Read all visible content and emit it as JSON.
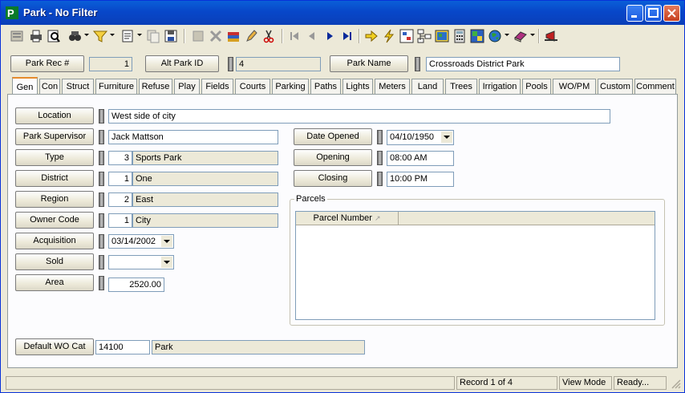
{
  "window": {
    "title": "Park - No Filter",
    "colors": {
      "titlebar": "#0a5fd8",
      "close": "#c7401f",
      "face": "#ece9d8"
    }
  },
  "toolbar": {
    "icons": [
      "new-record-icon",
      "print-icon",
      "preview-icon",
      "find-icon",
      "filter-icon",
      "report-icon",
      "copy-icon",
      "save-icon",
      "delete-icon",
      "attach-icon",
      "edit-icon",
      "cut-icon",
      "first-record-icon",
      "prev-record-icon",
      "next-record-icon",
      "last-record-icon",
      "go-icon",
      "lightning-icon",
      "hierarchy-icon",
      "tree-icon",
      "map-icon",
      "calculator-icon",
      "gis-icon",
      "globe-icon",
      "book-icon",
      "exit-icon"
    ]
  },
  "header": {
    "rec_label": "Park Rec #",
    "rec_value": "1",
    "alt_label": "Alt Park ID",
    "alt_value": "4",
    "name_label": "Park Name",
    "name_value": "Crossroads District Park"
  },
  "tabs": [
    "Gen",
    "Con",
    "Struct",
    "Furniture",
    "Refuse",
    "Play",
    "Fields",
    "Courts",
    "Parking",
    "Paths",
    "Lights",
    "Meters",
    "Land",
    "Trees",
    "Irrigation",
    "Pools",
    "WO/PM",
    "Custom",
    "Comment"
  ],
  "general": {
    "location": {
      "label": "Location",
      "value": "West side of city"
    },
    "supervisor": {
      "label": "Park Supervisor",
      "value": "Jack Mattson"
    },
    "type": {
      "label": "Type",
      "code": "3",
      "value": "Sports Park"
    },
    "district": {
      "label": "District",
      "code": "1",
      "value": "One"
    },
    "region": {
      "label": "Region",
      "code": "2",
      "value": "East"
    },
    "owner": {
      "label": "Owner Code",
      "code": "1",
      "value": "City"
    },
    "acquisition": {
      "label": "Acquisition",
      "value": "03/14/2002"
    },
    "sold": {
      "label": "Sold",
      "value": " / /"
    },
    "area": {
      "label": "Area",
      "value": "2520.00"
    },
    "date_opened": {
      "label": "Date Opened",
      "value": "04/10/1950"
    },
    "opening": {
      "label": "Opening",
      "value": "08:00 AM"
    },
    "closing": {
      "label": "Closing",
      "value": "10:00 PM"
    },
    "parcels": {
      "label": "Parcels",
      "column": "Parcel Number"
    },
    "wo_cat": {
      "label": "Default WO Cat",
      "code": "14100",
      "value": "Park"
    }
  },
  "status": {
    "record": "Record 1 of 4",
    "mode": "View Mode",
    "state": "Ready..."
  }
}
